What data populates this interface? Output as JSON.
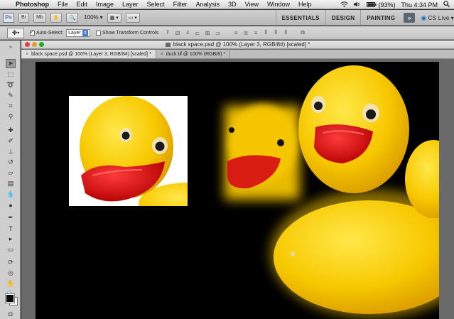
{
  "menubar": {
    "apple": "",
    "app_name": "Photoshop",
    "items": [
      "File",
      "Edit",
      "Image",
      "Layer",
      "Select",
      "Filter",
      "Analysis",
      "3D",
      "View",
      "Window",
      "Help"
    ],
    "battery": "(93%)",
    "clock": "Thu 4:34 PM"
  },
  "appbar": {
    "logo": "Ps",
    "btn1": "Br",
    "btn2": "Mb",
    "zoom": "100%",
    "workspaces": [
      "ESSENTIALS",
      "DESIGN",
      "PAINTING"
    ],
    "more": "»",
    "cs_live": "CS Live"
  },
  "options": {
    "auto_select_label": "Auto-Select:",
    "auto_select_checked": true,
    "auto_select_value": "Layer",
    "transform_label": "Show Transform Controls",
    "transform_checked": false
  },
  "document": {
    "window_title": "black space.psd @ 100% (Layer 3, RGB/8#) [scaled] *",
    "tabs": [
      {
        "label": "black space.psd @ 100% (Layer 3, RGB/8#) [scaled] *",
        "active": true
      },
      {
        "label": "duck.tif @ 100% (RGB/8) *",
        "active": false
      }
    ]
  },
  "colors": {
    "canvas": "#000000",
    "duck_yellow": "#f5c400",
    "duck_beak": "#d81414",
    "fg_swatch": "#000000",
    "bg_swatch": "#ffffff"
  }
}
